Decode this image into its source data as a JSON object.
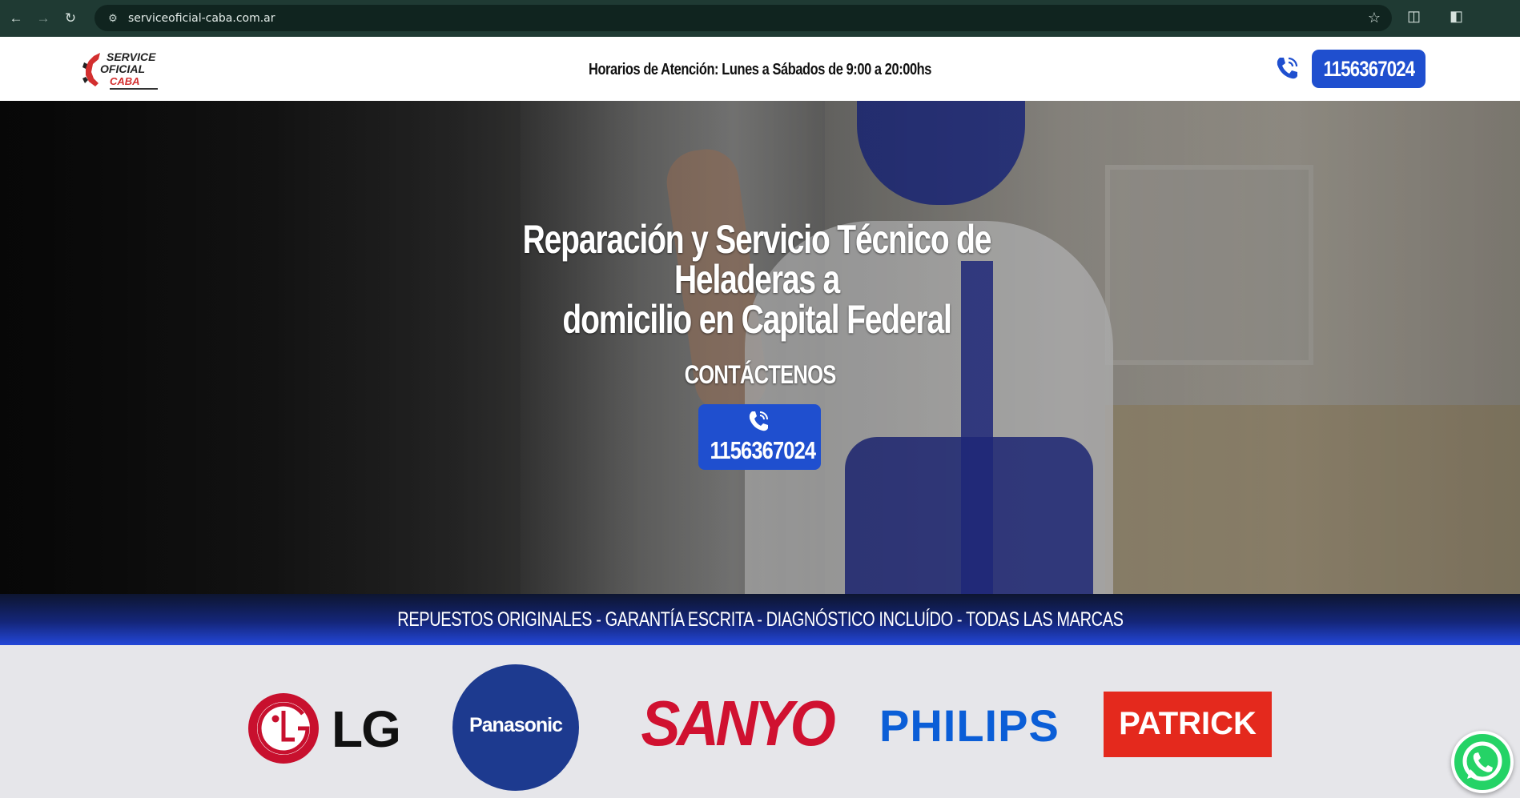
{
  "browser": {
    "url": "serviceoficial-caba.com.ar",
    "icons": [
      "back-icon",
      "forward-icon",
      "reload-icon",
      "site-settings-icon",
      "bookmark-star-icon",
      "extensions-icon",
      "side-panel-icon"
    ]
  },
  "header": {
    "logo": {
      "line1": "SERVICE",
      "line2": "OFICIAL",
      "line3": "CABA"
    },
    "hours": "Horarios de Atención: Lunes a Sábados de 9:00 a 20:00hs",
    "phone": "1156367024"
  },
  "hero": {
    "title_line1": "Reparación y Servicio Técnico de Heladeras a",
    "title_line2": "domicilio en Capital Federal",
    "contact_label": "CONTÁCTENOS",
    "phone": "1156367024"
  },
  "banner": {
    "text": "REPUESTOS ORIGINALES - GARANTÍA ESCRITA - DIAGNÓSTICO INCLUÍDO - TODAS LAS MARCAS"
  },
  "brands": [
    "LG",
    "Panasonic",
    "SANYO",
    "PHILIPS",
    "PATRICK"
  ],
  "colors": {
    "accent_blue": "#1f4fcf",
    "chrome_bg": "#1f3a33",
    "whatsapp_green": "#25d366"
  }
}
